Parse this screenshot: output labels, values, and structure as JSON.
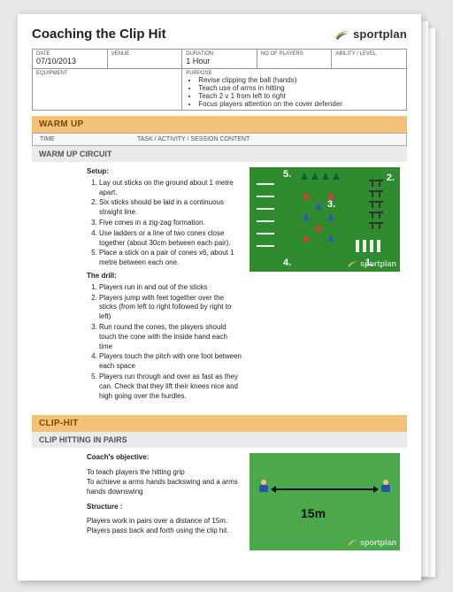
{
  "header": {
    "title": "Coaching the Clip Hit",
    "brand": "sportplan"
  },
  "meta": {
    "date_label": "DATE",
    "date_value": "07/10/2013",
    "venue_label": "VENUE",
    "venue_value": "",
    "duration_label": "DURATION",
    "duration_value": "1 Hour",
    "players_label": "NO OF PLAYERS",
    "players_value": "",
    "ability_label": "ABILITY / LEVEL",
    "ability_value": "",
    "equipment_label": "EQUIPMENT",
    "equipment_value": "",
    "purpose_label": "PURPOSE",
    "purpose_items": [
      "Revise clipping the ball (hands)",
      "Teach use of arms in hitting",
      "Teach 2 v 1 from left to right",
      "Focus players attention on the cover defender"
    ]
  },
  "sections": {
    "warmup_band": "WARM UP",
    "time_header": "TIME",
    "task_header": "TASK / ACTIVITY / SESSION CONTENT",
    "warmup_sub": "WARM UP CIRCUIT",
    "cliphit_band": "CLIP-HIT",
    "cliphit_sub": "CLIP HITTING IN PAIRS"
  },
  "warmup": {
    "setup_label": "Setup:",
    "setup_items": [
      "Lay out sticks on the ground about 1 metre apart.",
      "Six sticks should be laid in a continuous straight line.",
      "Five cones in a zig-zag formation.",
      "Use ladders or a line of two cones close together (about 30cm between each pair).",
      "Place a stick on a pair of cones x6, about 1 metre between each one."
    ],
    "drill_label": "The drill:",
    "drill_items": [
      "Players run in and out of the sticks",
      "Players jump with feet together over the sticks (from left to right followed by right to left)",
      "Run round the cones, the players should touch the cone with the inside hand each time",
      "Players touch the pitch with one foot between each space",
      "Players run through and over as fast as they can. Check that they lift their knees nice and high going over the hurdles."
    ],
    "diagram_labels": {
      "n1": "1.",
      "n2": "2.",
      "n3": "3.",
      "n4": "4.",
      "n5": "5."
    }
  },
  "cliphit": {
    "objective_label": "Coach's objective:",
    "objective_text1": "To teach players the hitting grip",
    "objective_text2": "To achieve a arms hands backswing and a arms hands downswing",
    "structure_label": "Structure :",
    "structure_text": "Players work in pairs over a distance of 15m. Players pass back and forth using the clip hit.",
    "distance": "15m"
  }
}
